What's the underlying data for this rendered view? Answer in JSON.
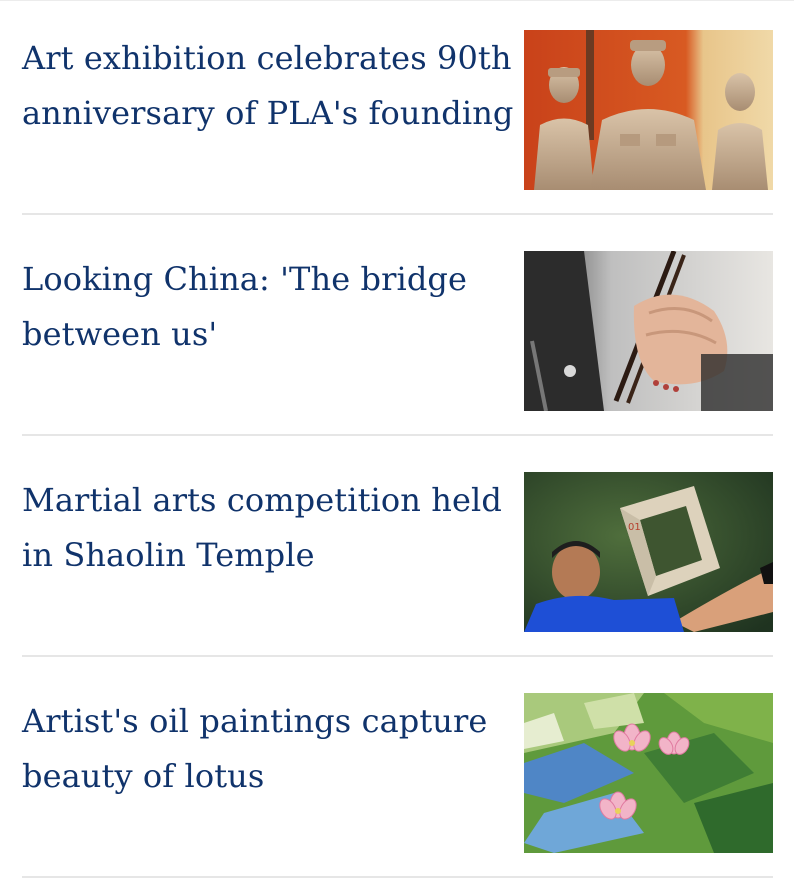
{
  "articles": [
    {
      "title": "Art exhibition celebrates 90th anniversary of PLA's founding",
      "image": "soldier-sculptures",
      "has_video": false
    },
    {
      "title": "Looking China: 'The bridge between us'",
      "image": "hand-with-chopsticks",
      "has_video": true
    },
    {
      "title": "Martial arts competition held in Shaolin Temple",
      "image": "man-lifting-stone-lock",
      "has_video": false
    },
    {
      "title": "Artist's oil paintings capture beauty of lotus",
      "image": "lotus-oil-painting",
      "has_video": false
    }
  ],
  "icons": {
    "play": "play-circle-icon"
  },
  "colors": {
    "title_text": "#10336b",
    "divider": "#e6e6e6"
  }
}
